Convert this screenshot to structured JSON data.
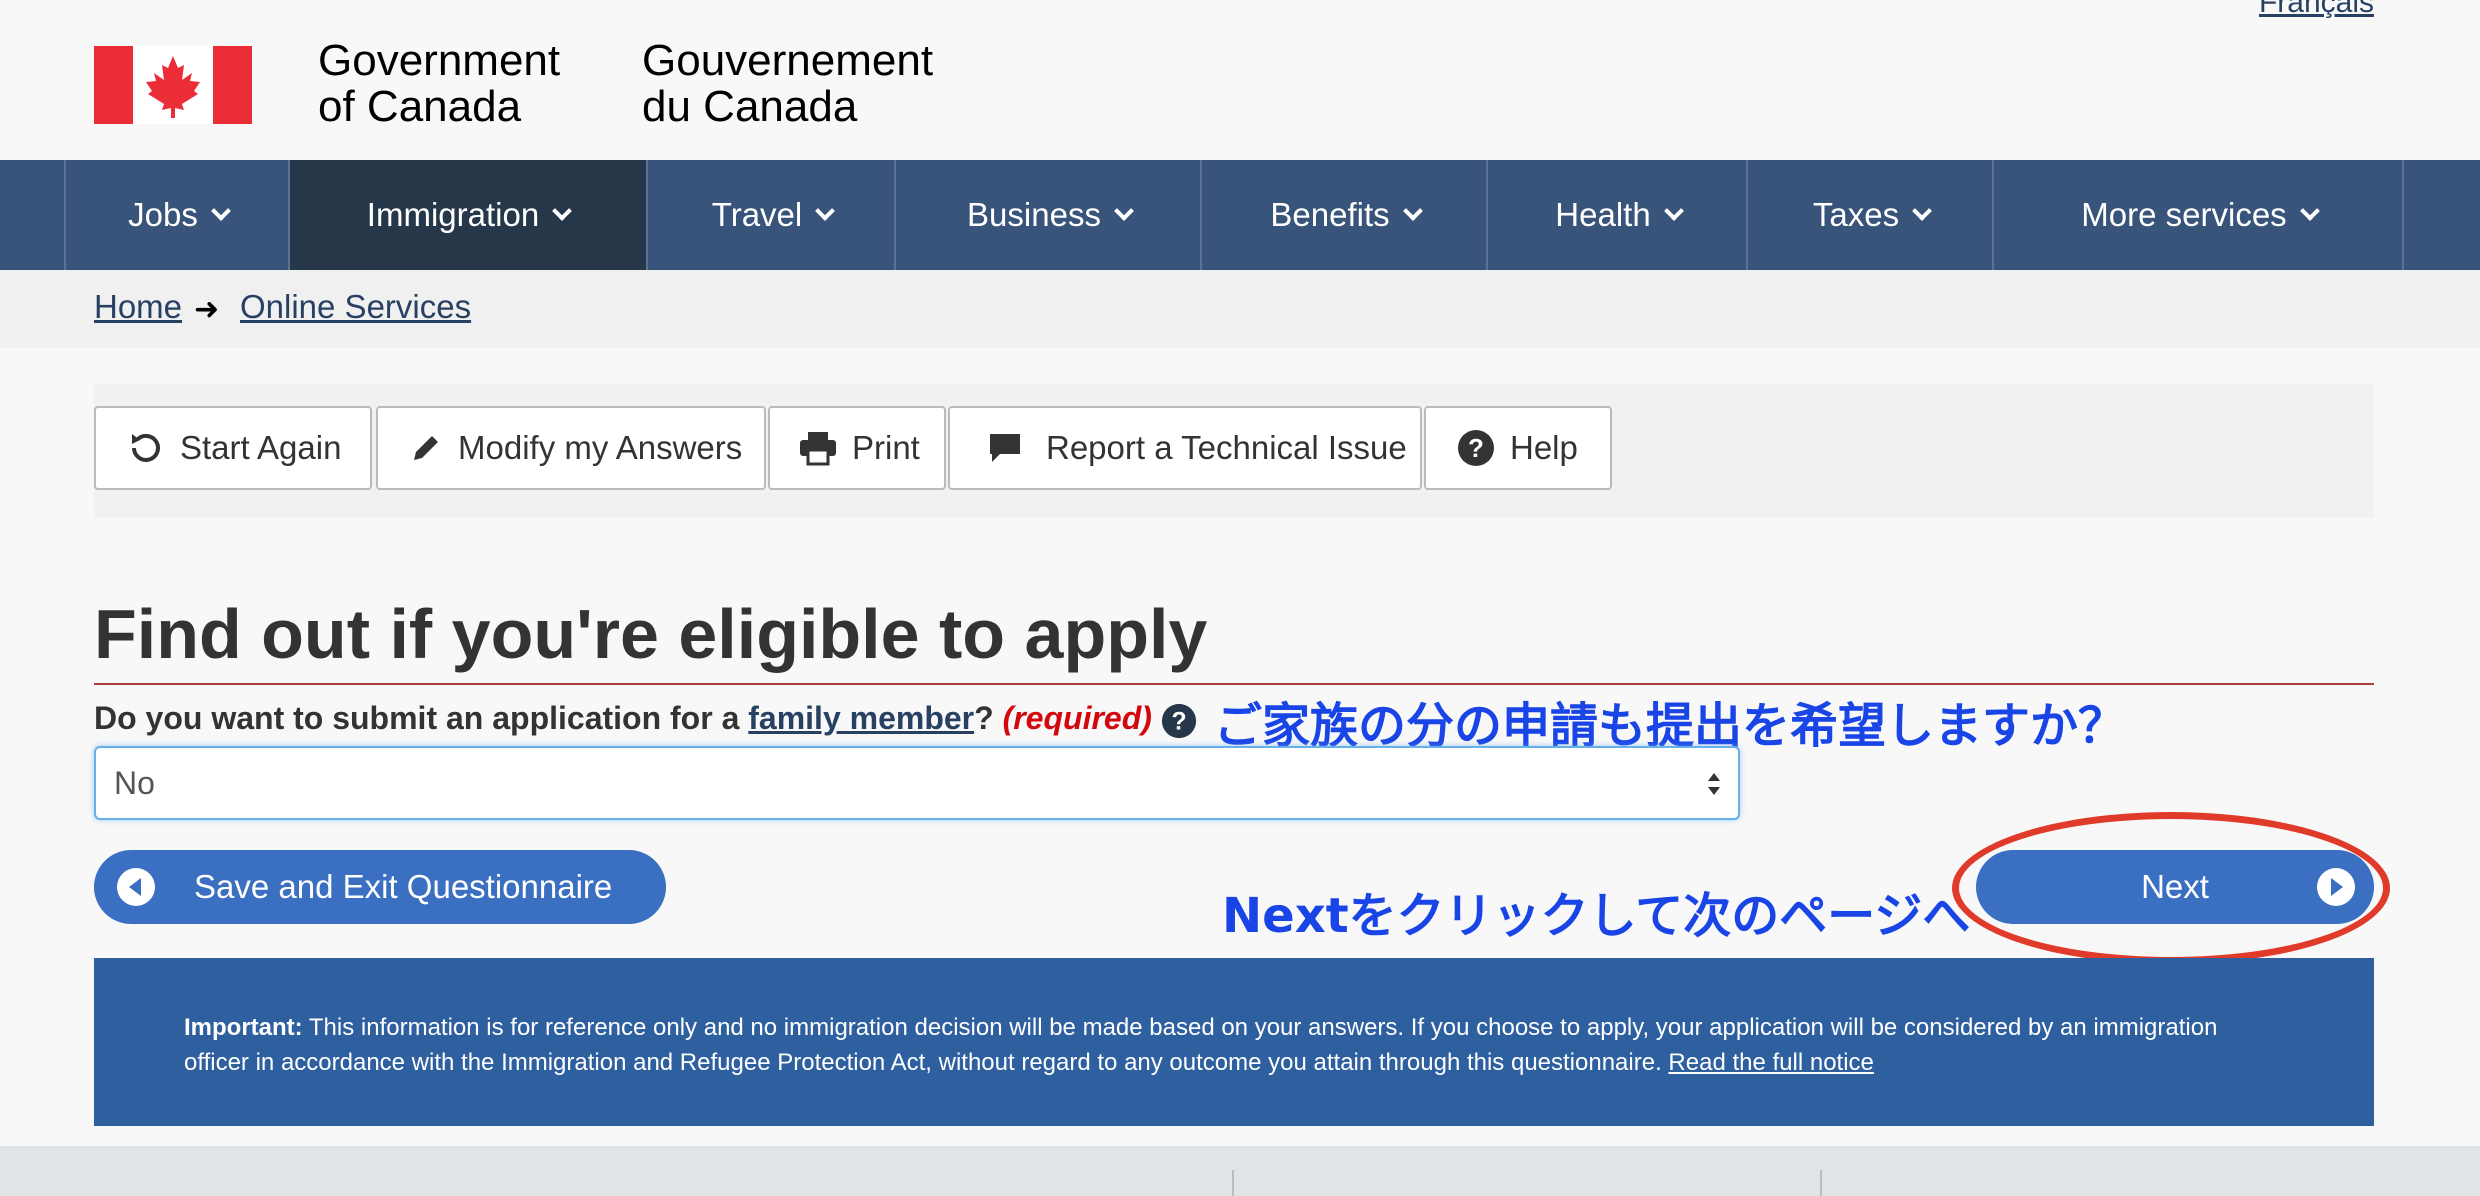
{
  "header": {
    "gov_en": "Government\nof Canada",
    "gov_en_line1": "Government",
    "gov_en_line2": "of Canada",
    "gov_fr_line1": "Gouvernement",
    "gov_fr_line2": "du Canada",
    "language_link": "Français"
  },
  "nav": {
    "items": [
      {
        "label": "Jobs"
      },
      {
        "label": "Immigration",
        "active": true
      },
      {
        "label": "Travel"
      },
      {
        "label": "Business"
      },
      {
        "label": "Benefits"
      },
      {
        "label": "Health"
      },
      {
        "label": "Taxes"
      },
      {
        "label": "More services"
      }
    ]
  },
  "breadcrumb": {
    "items": [
      "Home",
      "Online Services"
    ]
  },
  "toolbar": {
    "start_again": "Start Again",
    "modify_answers": "Modify my Answers",
    "print": "Print",
    "report_issue": "Report a Technical Issue",
    "help": "Help"
  },
  "page": {
    "title": "Find out if you're eligible to apply"
  },
  "question": {
    "prefix": "Do you want to submit an application for a ",
    "link": "family member",
    "suffix": "?",
    "required": "(required)",
    "selected": "No",
    "annotation_jp": "ご家族の分の申請も提出を希望しますか？"
  },
  "actions": {
    "save_exit": "Save and Exit Questionnaire",
    "next": "Next",
    "annotation_jp": "Nextをクリックして次のページへ"
  },
  "notice": {
    "label": "Important:",
    "text": " This information is for reference only and no immigration decision will be made based on your answers. If you choose to apply, your application will be considered by an immigration officer in accordance with the Immigration and Refugee Protection Act, without regard to any outcome you attain through this questionnaire. ",
    "link": "Read the full notice"
  },
  "colors": {
    "nav_bg": "#38547a",
    "nav_active": "#26374a",
    "button_blue": "#3a6fc2",
    "notice_bg": "#2e5f9f",
    "annotation_blue": "#1a45e6",
    "annotation_red": "#e03a2a",
    "required_red": "#d3080c"
  }
}
